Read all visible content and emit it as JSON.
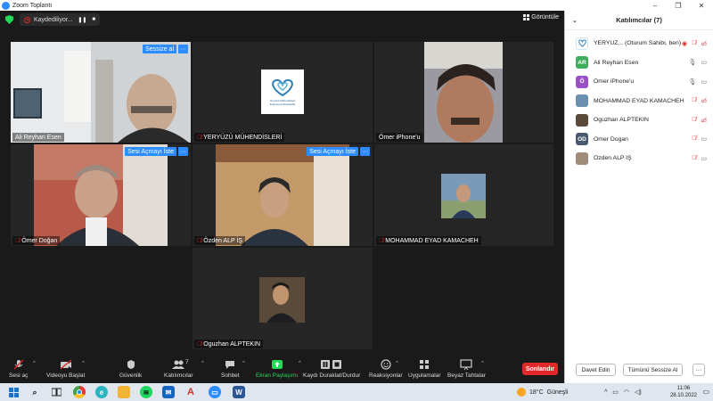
{
  "window": {
    "title": "Zoom Toplantı",
    "controls": [
      "–",
      "❐",
      "✕"
    ]
  },
  "recording": {
    "label": "Kaydediliyor..."
  },
  "view_button": {
    "label": "Görüntüle"
  },
  "tiles": [
    {
      "name": "Ali Reyhan Esen",
      "tag": "Sessize al",
      "muted": false
    },
    {
      "name": "YERYÜZÜ MÜHENDİSLERİ",
      "muted": true,
      "logo_line1": "Yeryüzü Mühendisleri",
      "logo_line2": "Engineers Worldwide"
    },
    {
      "name": "Ömer iPhone'u",
      "muted": false
    },
    {
      "name": "Ömer Doğan",
      "tag": "Sesi Açmayı İste",
      "muted": true
    },
    {
      "name": "Özden ALP İŞ",
      "tag": "Sesi Açmayı İste",
      "muted": true
    },
    {
      "name": "MOHAMMAD EYAD KAMACHEH",
      "muted": true
    },
    {
      "name": "Oguzhan ALPTEKIN",
      "muted": true
    }
  ],
  "toolbar": {
    "audio": "Sesi aç",
    "video": "Videoyu Başlat",
    "security": "Güvenlik",
    "participants": "Katılımcılar",
    "participants_count": "7",
    "chat": "Sohbet",
    "share": "Ekran Paylaşımı",
    "pause_record": "Kaydı Duraklat/Durdur",
    "reactions": "Reaksiyonlar",
    "apps": "Uygulamalar",
    "whiteboard": "Beyaz Tahtalar",
    "end": "Sonlandır"
  },
  "panel": {
    "title": "Katılımcılar (7)",
    "participants": [
      {
        "name": "YERYÜZ... (Oturum Sahibi, ben)",
        "initials": "",
        "color": "#ffffff"
      },
      {
        "name": "Ali Reyhan Esen",
        "initials": "AR",
        "color": "#3fae5a"
      },
      {
        "name": "Ömer iPhone'u",
        "initials": "Ö",
        "color": "#9b4fc5"
      },
      {
        "name": "MOHAMMAD EYAD KAMACHEH",
        "initials": "",
        "color": "#6b8fb0"
      },
      {
        "name": "Oguzhan ALPTEKIN",
        "initials": "",
        "color": "#5a4a3a"
      },
      {
        "name": "Omer Dogan",
        "initials": "OD",
        "color": "#4a5a6e"
      },
      {
        "name": "Özden ALP İŞ",
        "initials": "",
        "color": "#a08a78"
      }
    ],
    "invite": "Davet Edin",
    "mute_all": "Tümünü Sessize Al",
    "more": "···"
  },
  "taskbar": {
    "temperature": "18°C",
    "weather": "Güneşli",
    "time": "11:06",
    "date": "28.10.2022"
  },
  "colors": {
    "accent": "#2d8cff",
    "danger": "#e02828",
    "active_speaker": "#d7e629"
  }
}
